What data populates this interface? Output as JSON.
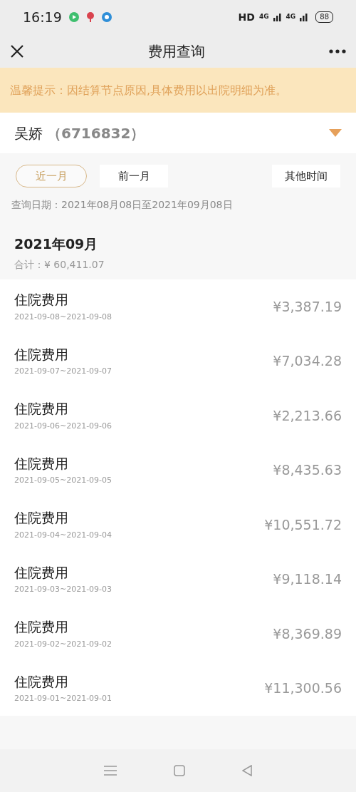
{
  "status_bar": {
    "time": "16:19",
    "network": "HD",
    "sim_1": "4G",
    "sim_2": "4G",
    "battery": "88"
  },
  "header": {
    "title": "费用查询"
  },
  "notice": "温馨提示：因结算节点原因,具体费用以出院明细为准。",
  "patient": {
    "name": "吴娇",
    "id": "（6716832）"
  },
  "tabs": [
    {
      "label": "近一月",
      "selected": true
    },
    {
      "label": "前一月",
      "selected": false
    },
    {
      "label": "其他时间",
      "selected": false
    }
  ],
  "query_range": "查询日期：2021年08月08日至2021年09月08日",
  "month": {
    "title": "2021年09月",
    "total": "合计：¥ 60,411.07"
  },
  "records": [
    {
      "title": "住院费用",
      "dates": "2021-09-08~2021-09-08",
      "amount": "¥3,387.19"
    },
    {
      "title": "住院费用",
      "dates": "2021-09-07~2021-09-07",
      "amount": "¥7,034.28"
    },
    {
      "title": "住院费用",
      "dates": "2021-09-06~2021-09-06",
      "amount": "¥2,213.66"
    },
    {
      "title": "住院费用",
      "dates": "2021-09-05~2021-09-05",
      "amount": "¥8,435.63"
    },
    {
      "title": "住院费用",
      "dates": "2021-09-04~2021-09-04",
      "amount": "¥10,551.72"
    },
    {
      "title": "住院费用",
      "dates": "2021-09-03~2021-09-03",
      "amount": "¥9,118.14"
    },
    {
      "title": "住院费用",
      "dates": "2021-09-02~2021-09-02",
      "amount": "¥8,369.89"
    },
    {
      "title": "住院费用",
      "dates": "2021-09-01~2021-09-01",
      "amount": "¥11,300.56"
    }
  ]
}
